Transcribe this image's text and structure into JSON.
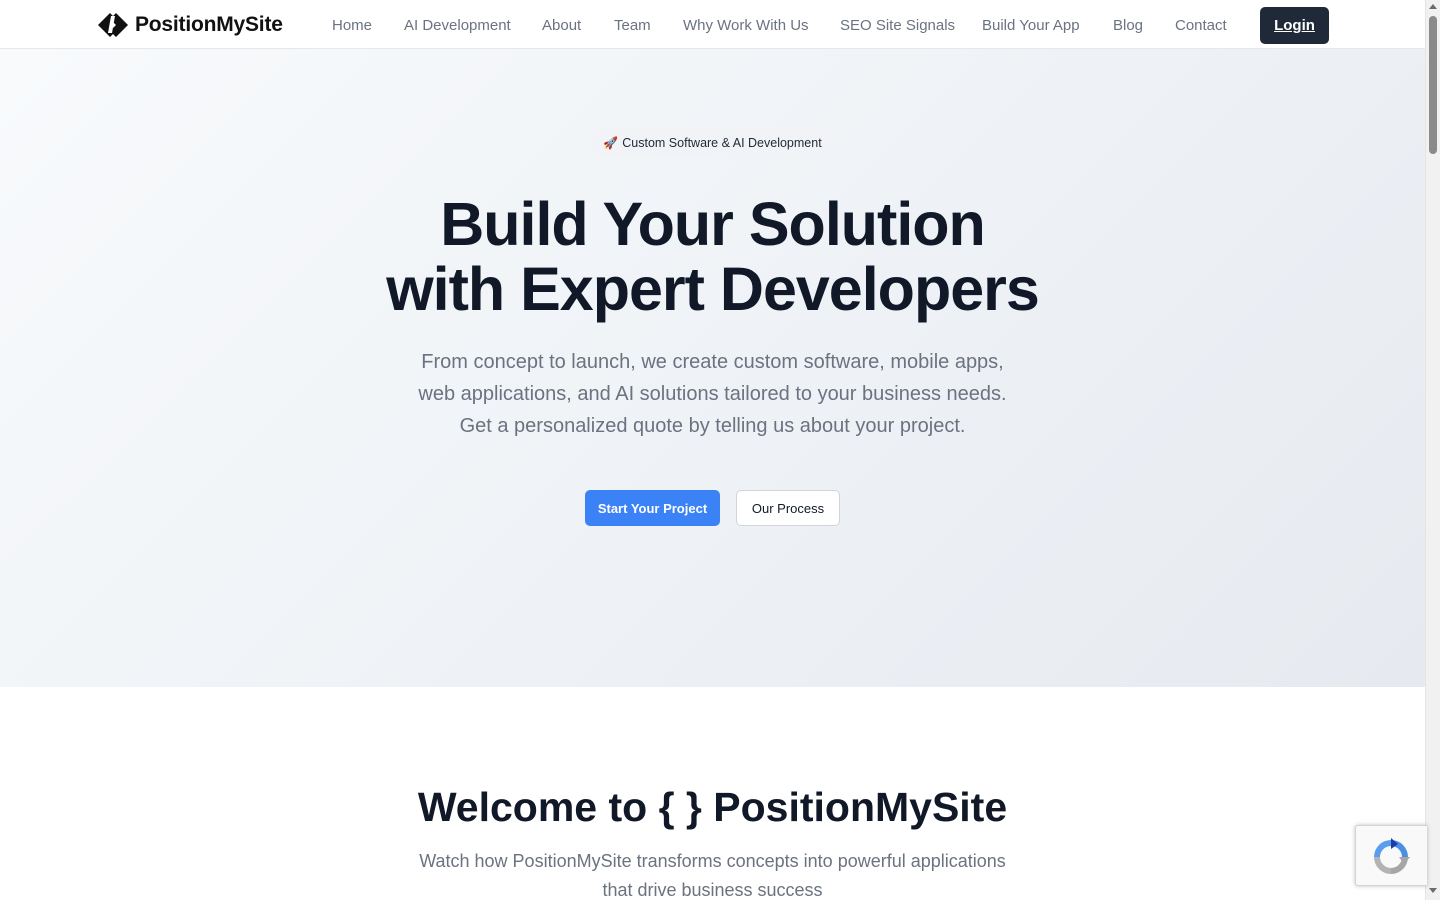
{
  "nav": {
    "logo_text": "PositionMySite",
    "links": [
      "Home",
      "AI Development",
      "About",
      "Team",
      "Why Work With Us",
      "SEO Site Signals",
      "Build Your App",
      "Blog",
      "Contact"
    ],
    "login_label": "Login"
  },
  "hero": {
    "badge_icon": "rocket-icon",
    "badge_emoji": "🚀",
    "badge_text": "Custom Software & AI Development",
    "title_line1": "Build Your Solution",
    "title_line2": "with Expert Developers",
    "subtitle_line1": "From concept to launch, we create custom software, mobile apps,",
    "subtitle_line2": "web applications, and AI solutions tailored to your business needs.",
    "subtitle_line3": "Get a personalized quote by telling us about your project.",
    "primary_button": "Start Your Project",
    "secondary_button": "Our Process"
  },
  "welcome": {
    "title": "Welcome to { } PositionMySite",
    "subtitle_line1": "Watch how PositionMySite transforms concepts into powerful applications",
    "subtitle_line2": "that drive business success"
  },
  "colors": {
    "primary_button": "#3b82f6",
    "login_button": "#1f2937",
    "heading": "#111827",
    "muted_text": "#6b7280"
  }
}
